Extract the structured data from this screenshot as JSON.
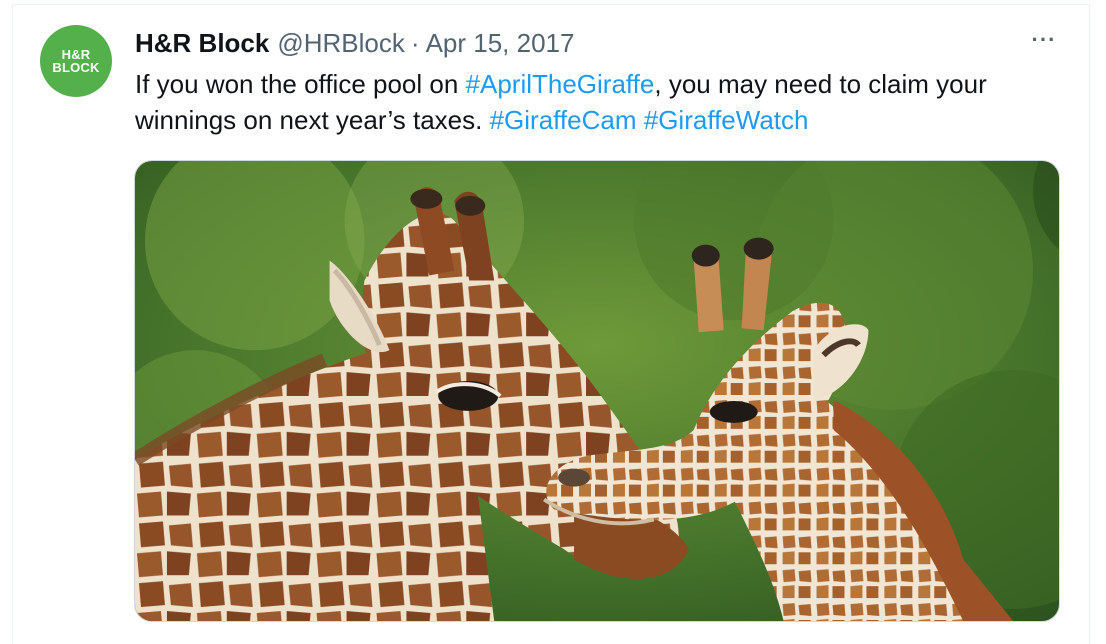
{
  "tweet": {
    "author_name": "H&R Block",
    "author_handle": "@HRBlock",
    "separator": "·",
    "date": "Apr 15, 2017",
    "more_icon": "more-horizontal-icon",
    "avatar": {
      "line1": "H&R",
      "line2": "BLOCK",
      "color": "#54b04a"
    },
    "text_parts": {
      "p1": "If you won the office pool on ",
      "tag1": "#AprilTheGiraffe",
      "p2": ", you may need to claim your winnings on next year’s taxes. ",
      "tag2": "#GiraffeCam",
      "space": " ",
      "tag3": "#GiraffeWatch"
    },
    "colors": {
      "link": "#1d9bf0",
      "text": "#0f1419",
      "muted": "#536471"
    }
  }
}
